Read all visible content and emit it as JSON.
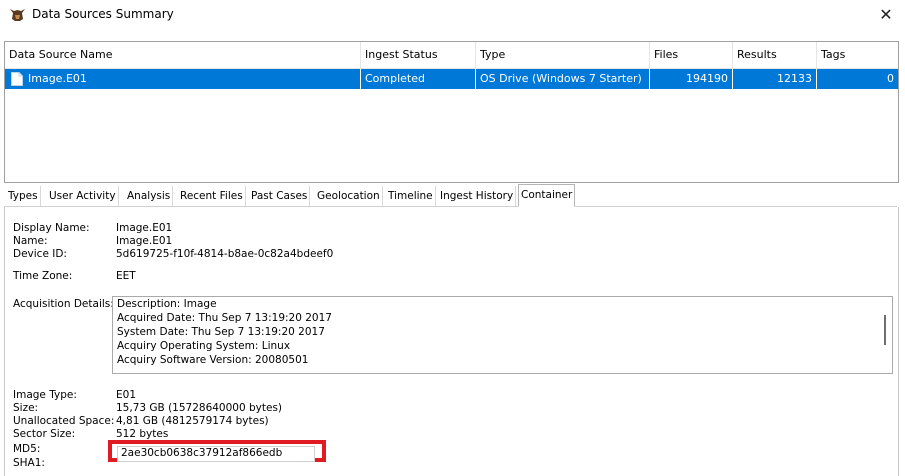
{
  "window": {
    "title": "Data Sources Summary",
    "close_glyph": "✕"
  },
  "table": {
    "headers": [
      "Data Source Name",
      "Ingest Status",
      "Type",
      "Files",
      "Results",
      "Tags"
    ],
    "rows": [
      {
        "name": "Image.E01",
        "status": "Completed",
        "type": "OS Drive (Windows 7 Starter)",
        "files": "194190",
        "results": "12133",
        "tags": "0"
      }
    ]
  },
  "tabs": [
    "Types",
    "User Activity",
    "Analysis",
    "Recent Files",
    "Past Cases",
    "Geolocation",
    "Timeline",
    "Ingest History",
    "Container"
  ],
  "container": {
    "display_name_label": "Display Name:",
    "display_name": "Image.E01",
    "name_label": "Name:",
    "name": "Image.E01",
    "device_id_label": "Device ID:",
    "device_id": "5d619725-f10f-4814-b8ae-0c82a4bdeef0",
    "time_zone_label": "Time Zone:",
    "time_zone": "EET",
    "acquisition_label": "Acquisition Details:",
    "acquisition_lines": [
      "Description: Image",
      "Acquired Date: Thu Sep  7 13:19:20 2017",
      "System Date: Thu Sep  7 13:19:20 2017",
      "Acquiry Operating System: Linux",
      "Acquiry Software Version: 20080501"
    ],
    "image_type_label": "Image Type:",
    "image_type": "E01",
    "size_label": "Size:",
    "size": "15,73 GB (15728640000 bytes)",
    "unallocated_label": "Unallocated Space:",
    "unallocated": "4,81 GB (4812579174 bytes)",
    "sector_size_label": "Sector Size:",
    "sector_size": "512 bytes",
    "md5_label": "MD5:",
    "md5": "2ae30cb0638c37912af866edb",
    "sha1_label": "SHA1:"
  },
  "colors": {
    "selection": "#0078d7",
    "highlight_box": "#e01b24"
  }
}
